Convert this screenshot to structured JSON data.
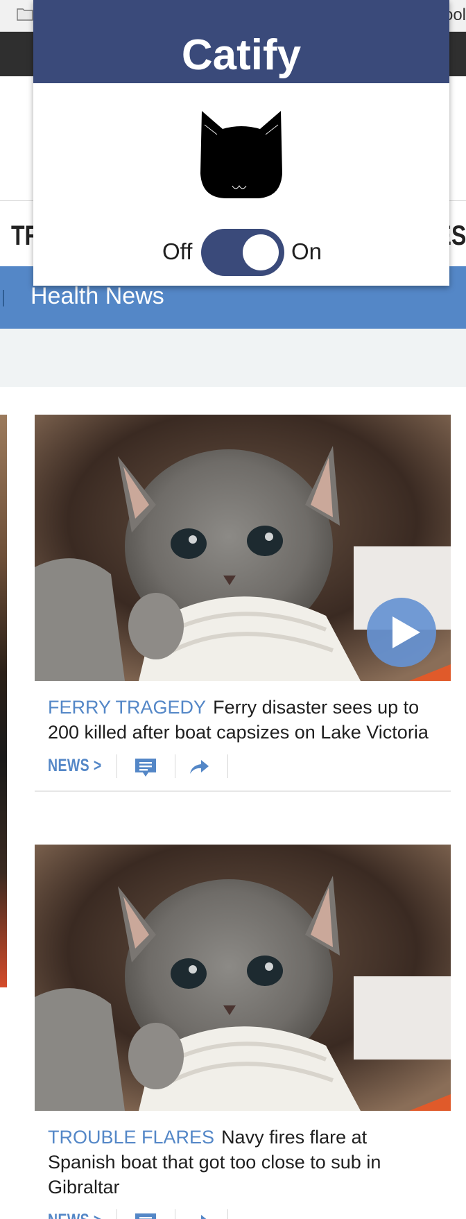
{
  "browser": {
    "bookmark_label": "ool"
  },
  "nav": {
    "left_text": "TR",
    "right_text": "ES"
  },
  "section": {
    "title": "Health News"
  },
  "articles": [
    {
      "kicker": "FERRY TRAGEDY",
      "headline": "Ferry disaster sees up to 200 killed after boat capsizes on Lake Victoria",
      "category_link": "NEWS >",
      "has_play_button": true
    },
    {
      "kicker": "TROUBLE FLARES",
      "headline": "Navy fires flare at Spanish boat that got too close to sub in Gibraltar",
      "category_link": "NEWS >",
      "has_play_button": false
    }
  ],
  "popup": {
    "title": "Catify",
    "toggle": {
      "off_label": "Off",
      "on_label": "On",
      "state": "on"
    }
  },
  "icons": {
    "folder": "folder-icon",
    "play": "play-icon",
    "comment": "comment-icon",
    "share": "share-icon",
    "cat": "cat-head-icon"
  },
  "colors": {
    "popup_header": "#3a4a7a",
    "section_bar": "#5487c7",
    "kicker": "#5487c7",
    "toggle_track": "#3a4a7a"
  }
}
